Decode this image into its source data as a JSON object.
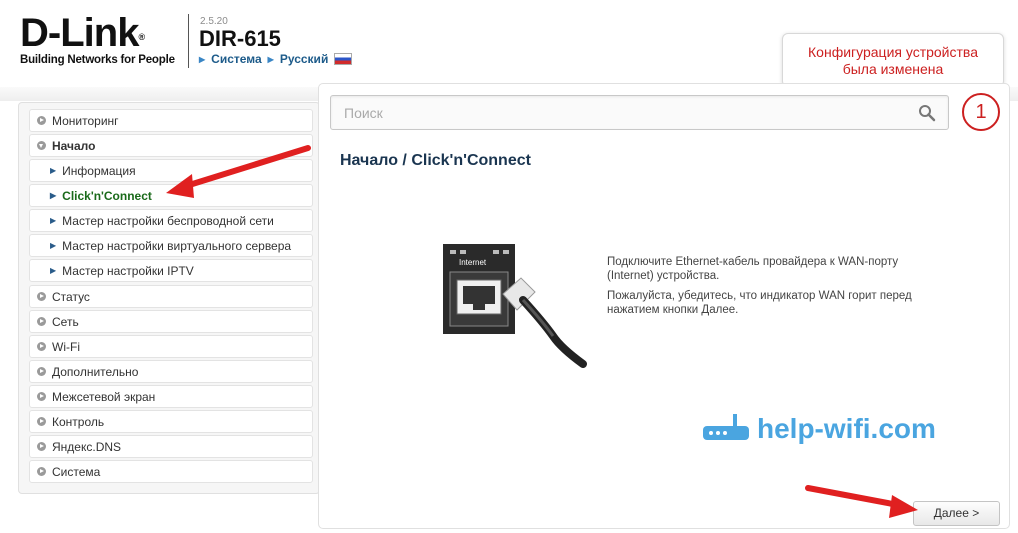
{
  "header": {
    "brand": "D-Link",
    "brand_reg": "®",
    "tagline": "Building Networks for People",
    "firmware": "2.5.20",
    "model": "DIR-615",
    "nav_system": "Система",
    "nav_language": "Русский"
  },
  "notification": {
    "line1": "Конфигурация устройства",
    "line2": "была изменена",
    "count": "1"
  },
  "search": {
    "placeholder": "Поиск"
  },
  "sidebar": {
    "items": [
      {
        "label": "Мониторинг"
      },
      {
        "label": "Начало"
      },
      {
        "label": "Информация"
      },
      {
        "label": "Click'n'Connect"
      },
      {
        "label": "Мастер настройки беспроводной сети"
      },
      {
        "label": "Мастер настройки виртуального сервера"
      },
      {
        "label": "Мастер настройки IPTV"
      },
      {
        "label": "Статус"
      },
      {
        "label": "Сеть"
      },
      {
        "label": "Wi-Fi"
      },
      {
        "label": "Дополнительно"
      },
      {
        "label": "Межсетевой экран"
      },
      {
        "label": "Контроль"
      },
      {
        "label": "Яндекс.DNS"
      },
      {
        "label": "Система"
      }
    ]
  },
  "main": {
    "breadcrumb_root": "Начало /",
    "breadcrumb_page": "Click'n'Connect",
    "port_label": "Internet",
    "instruction_1": "Подключите Ethernet-кабель провайдера к WAN-порту (Internet) устройства.",
    "instruction_2": "Пожалуйста, убедитесь, что индикатор WAN горит перед нажатием кнопки Далее.",
    "next_button": "Далее >"
  },
  "watermark": {
    "text": "help-wifi.com"
  },
  "colors": {
    "accent_red": "#cc2020",
    "link_blue": "#1d5b8a",
    "active_green": "#1a6a1a",
    "watermark_blue": "#4aa5e0",
    "annotation_red": "#e02020"
  }
}
